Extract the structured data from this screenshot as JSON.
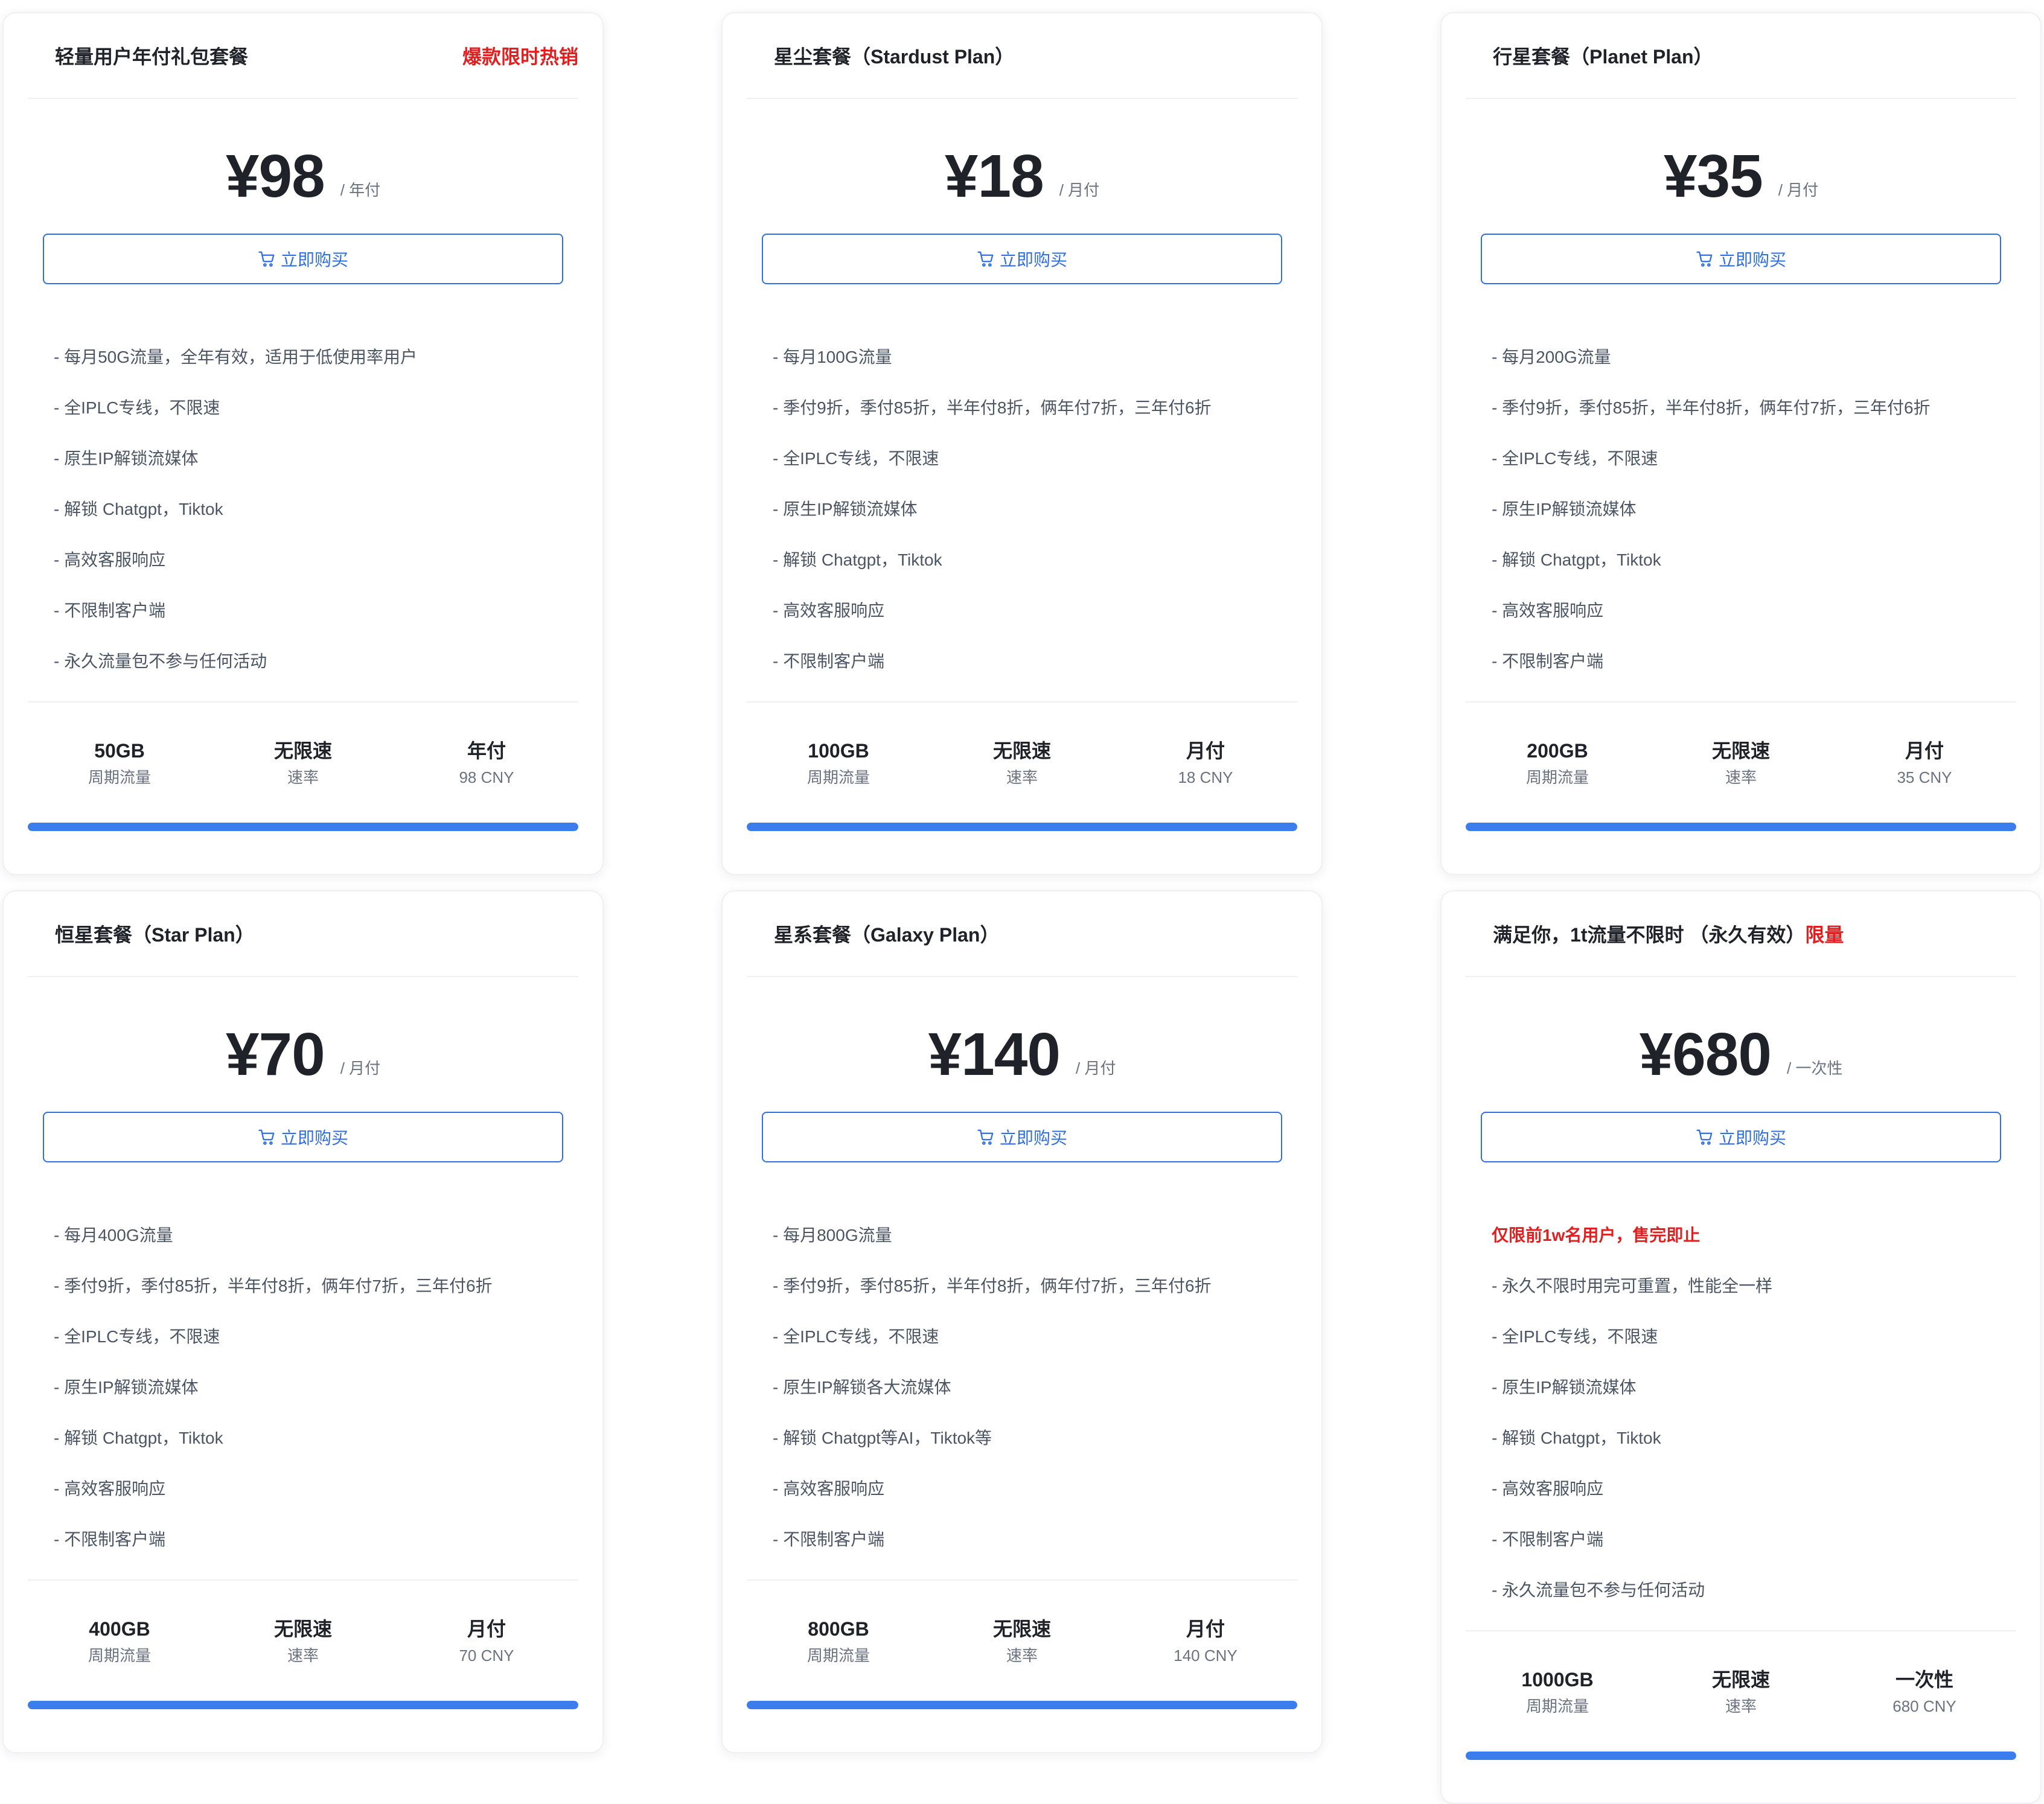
{
  "buy_label": "立即购买",
  "icons": {
    "cart": "shopping-cart-icon"
  },
  "colors": {
    "accent": "#2f6fe0",
    "bar": "#3b7ded",
    "hot": "#e02020"
  },
  "plans": [
    {
      "title": "轻量用户年付礼包套餐",
      "title_highlight": "",
      "badge": "爆款限时热销",
      "price": "¥98",
      "period": "/ 年付",
      "note": "",
      "features": [
        "- 每月50G流量，全年有效，适用于低使用率用户",
        "- 全IPLC专线，不限速",
        "- 原生IP解锁流媒体",
        "- 解锁 Chatgpt，Tiktok",
        "- 高效客服响应",
        "- 不限制客户端",
        "- 永久流量包不参与任何活动"
      ],
      "stats": [
        {
          "value": "50GB",
          "label": "周期流量"
        },
        {
          "value": "无限速",
          "label": "速率"
        },
        {
          "value": "年付",
          "label": "98 CNY"
        }
      ],
      "progress": 1.0
    },
    {
      "title": "星尘套餐（Stardust Plan）",
      "title_highlight": "",
      "badge": "",
      "price": "¥18",
      "period": "/ 月付",
      "note": "",
      "features": [
        "- 每月100G流量",
        "- 季付9折，季付85折，半年付8折，俩年付7折，三年付6折",
        "- 全IPLC专线，不限速",
        "- 原生IP解锁流媒体",
        "- 解锁 Chatgpt，Tiktok",
        "- 高效客服响应",
        "- 不限制客户端"
      ],
      "stats": [
        {
          "value": "100GB",
          "label": "周期流量"
        },
        {
          "value": "无限速",
          "label": "速率"
        },
        {
          "value": "月付",
          "label": "18 CNY"
        }
      ],
      "progress": 1.0
    },
    {
      "title": "行星套餐（Planet Plan）",
      "title_highlight": "",
      "badge": "",
      "price": "¥35",
      "period": "/ 月付",
      "note": "",
      "features": [
        "- 每月200G流量",
        "- 季付9折，季付85折，半年付8折，俩年付7折，三年付6折",
        "- 全IPLC专线，不限速",
        "- 原生IP解锁流媒体",
        "- 解锁 Chatgpt，Tiktok",
        "- 高效客服响应",
        "- 不限制客户端"
      ],
      "stats": [
        {
          "value": "200GB",
          "label": "周期流量"
        },
        {
          "value": "无限速",
          "label": "速率"
        },
        {
          "value": "月付",
          "label": "35 CNY"
        }
      ],
      "progress": 1.0
    },
    {
      "title": "恒星套餐（Star Plan）",
      "title_highlight": "",
      "badge": "",
      "price": "¥70",
      "period": "/ 月付",
      "note": "",
      "features": [
        "- 每月400G流量",
        "- 季付9折，季付85折，半年付8折，俩年付7折，三年付6折",
        "- 全IPLC专线，不限速",
        "- 原生IP解锁流媒体",
        "- 解锁 Chatgpt，Tiktok",
        "- 高效客服响应",
        "- 不限制客户端"
      ],
      "stats": [
        {
          "value": "400GB",
          "label": "周期流量"
        },
        {
          "value": "无限速",
          "label": "速率"
        },
        {
          "value": "月付",
          "label": "70 CNY"
        }
      ],
      "progress": 1.0
    },
    {
      "title": "星系套餐（Galaxy Plan）",
      "title_highlight": "",
      "badge": "",
      "price": "¥140",
      "period": "/ 月付",
      "note": "",
      "features": [
        "- 每月800G流量",
        "- 季付9折，季付85折，半年付8折，俩年付7折，三年付6折",
        "- 全IPLC专线，不限速",
        "- 原生IP解锁各大流媒体",
        "- 解锁 Chatgpt等AI，Tiktok等",
        "- 高效客服响应",
        "- 不限制客户端"
      ],
      "stats": [
        {
          "value": "800GB",
          "label": "周期流量"
        },
        {
          "value": "无限速",
          "label": "速率"
        },
        {
          "value": "月付",
          "label": "140 CNY"
        }
      ],
      "progress": 1.0
    },
    {
      "title": "满足你，1t流量不限时 （永久有效）",
      "title_highlight": "限量",
      "badge": "",
      "price": "¥680",
      "period": "/ 一次性",
      "note": "仅限前1w名用户，售完即止",
      "features": [
        "- 永久不限时用完可重置，性能全一样",
        "- 全IPLC专线，不限速",
        "- 原生IP解锁流媒体",
        "- 解锁 Chatgpt，Tiktok",
        "- 高效客服响应",
        "- 不限制客户端",
        "- 永久流量包不参与任何活动"
      ],
      "stats": [
        {
          "value": "1000GB",
          "label": "周期流量"
        },
        {
          "value": "无限速",
          "label": "速率"
        },
        {
          "value": "一次性",
          "label": "680 CNY"
        }
      ],
      "progress": 1.0
    }
  ]
}
